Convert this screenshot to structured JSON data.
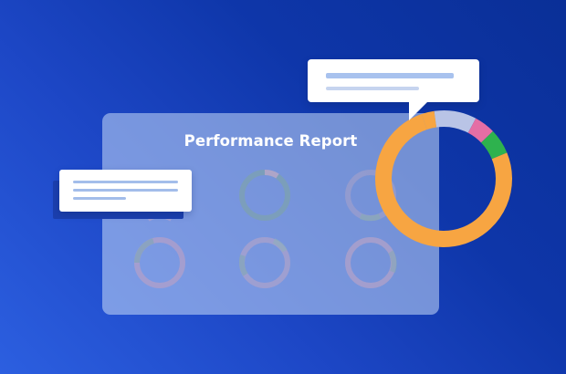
{
  "report": {
    "title": "Performance Report"
  },
  "mini_donuts": [
    {
      "color": "#6f9aa5",
      "accent": "#b8a0c8"
    },
    {
      "color": "#a89fc6",
      "accent": "#7fa7b3"
    },
    {
      "color": "#b5a0c7",
      "accent": "#7ba3b0"
    },
    {
      "color": "#a8a0c8",
      "accent": "#7aa3b2"
    },
    {
      "color": "#b9a2c9",
      "accent": "#82aab4"
    },
    {
      "color": "#b7a3c9",
      "accent": "#82a8b5"
    }
  ],
  "big_donut": {
    "segments": [
      {
        "color": "#f7a542",
        "share": 0.76
      },
      {
        "color": "#b9c4e6",
        "share": 0.1
      },
      {
        "color": "#e46ea5",
        "share": 0.05
      },
      {
        "color": "#2eb24e",
        "share": 0.06
      },
      {
        "color": "#f7a542",
        "share": 0.03
      }
    ]
  },
  "colors": {
    "background": "#1d47c6",
    "bubble_line_primary": "#a8c2ee",
    "bubble_line_secondary": "#c6d4ef"
  }
}
